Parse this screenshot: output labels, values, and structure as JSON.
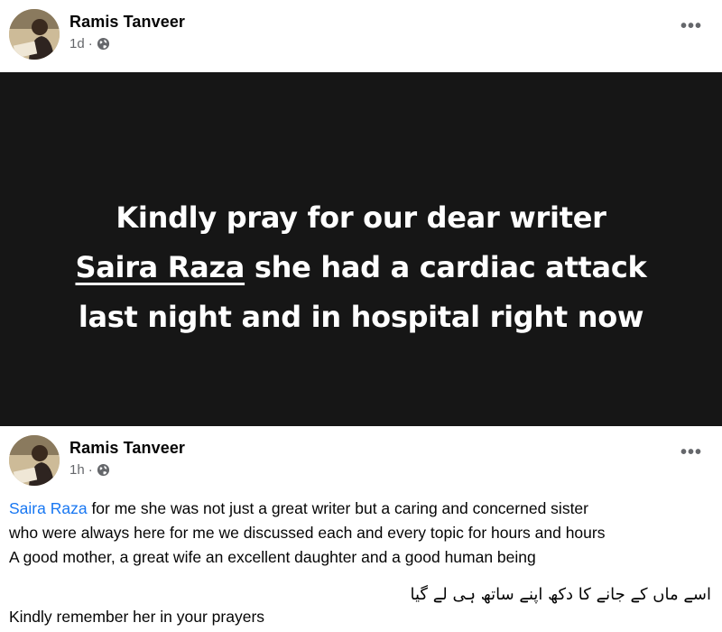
{
  "post1": {
    "author": "Ramis Tanveer",
    "time": "1d",
    "separator": "·",
    "more": "•••",
    "image_text": {
      "line1": "Kindly pray for our dear writer",
      "line2_name": "Saira Raza",
      "line2_rest": " she had a cardiac attack",
      "line3": "last night and in hospital right now"
    }
  },
  "post2": {
    "author": "Ramis Tanveer",
    "time": "1h",
    "separator": "·",
    "more": "•••",
    "mention": "Saira Raza",
    "text_line1_rest": " for me she was not just a great writer but a caring and concerned sister",
    "text_line2": "who were always here for me we discussed each and every topic for hours and hours",
    "text_line3": "A good mother, a great wife an excellent daughter and a good human being",
    "urdu_line": "اسے ماں کے جانے کا دکھ اپنے ساتھ ہی لے گیا",
    "closing": "Kindly remember her in your prayers"
  },
  "colors": {
    "mention": "#1877f2",
    "panel": "#161616",
    "meta": "#65676b"
  },
  "icons": [
    "globe-icon",
    "more-options-icon",
    "avatar"
  ]
}
